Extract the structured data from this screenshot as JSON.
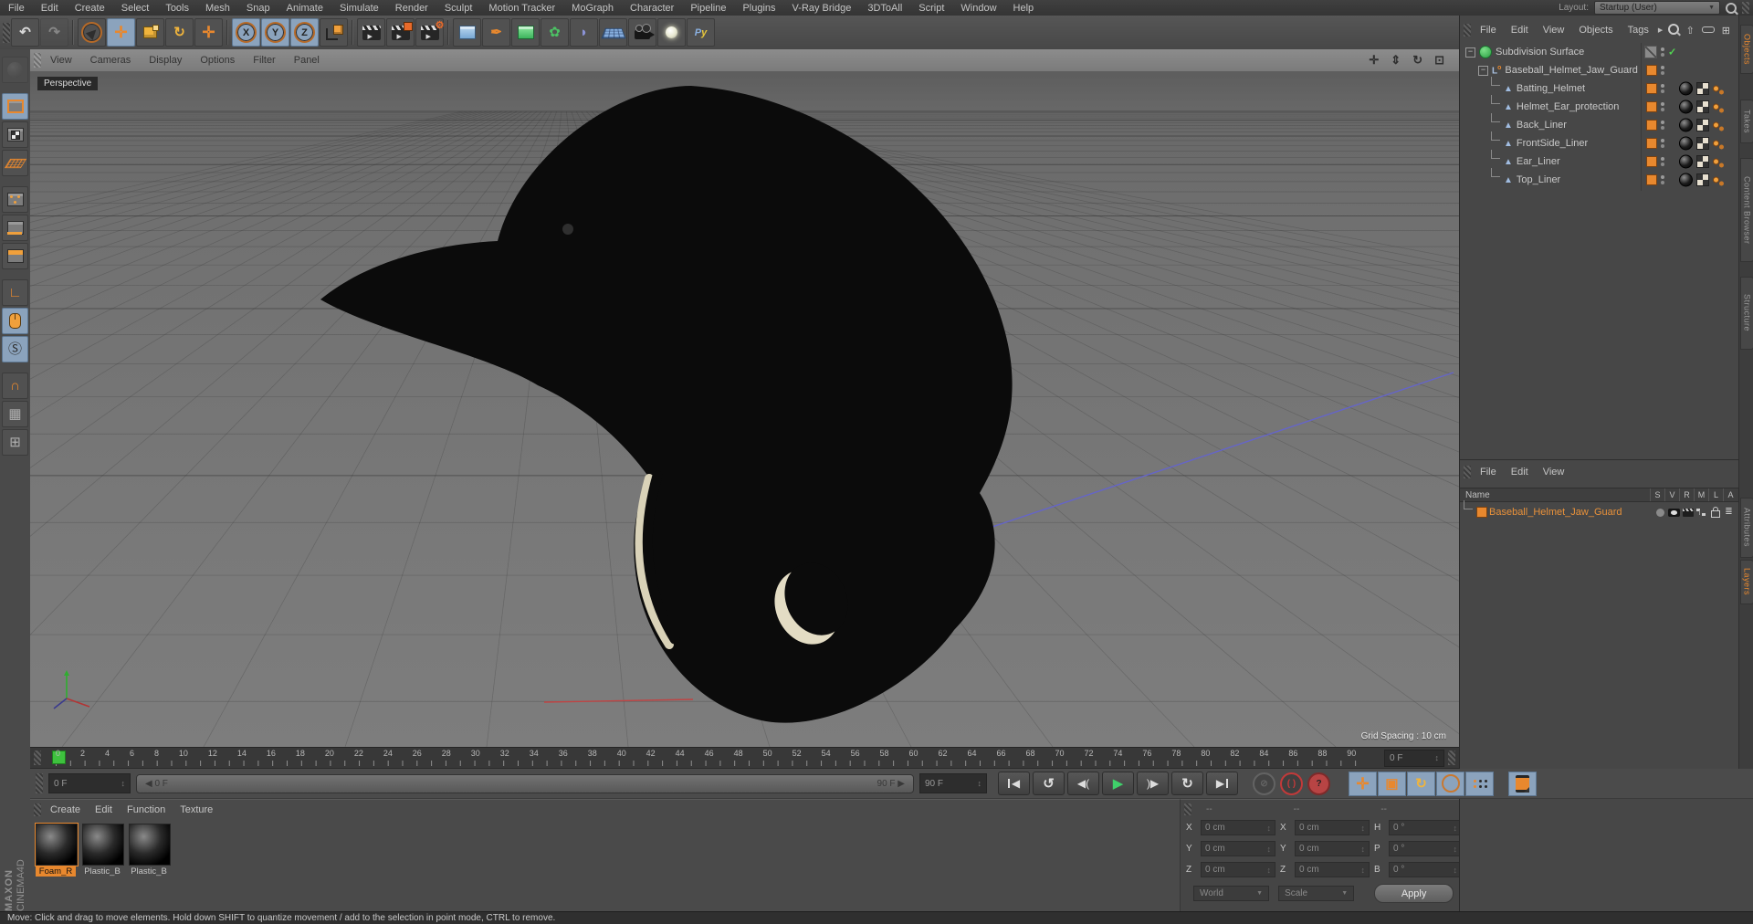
{
  "menubar": {
    "items": [
      "File",
      "Edit",
      "Create",
      "Select",
      "Tools",
      "Mesh",
      "Snap",
      "Animate",
      "Simulate",
      "Render",
      "Sculpt",
      "Motion Tracker",
      "MoGraph",
      "Character",
      "Pipeline",
      "Plugins",
      "V-Ray Bridge",
      "3DToAll",
      "Script",
      "Window",
      "Help"
    ],
    "layout_label": "Layout:",
    "layout_value": "Startup (User)"
  },
  "toolbar": {
    "items": [
      {
        "name": "undo-button",
        "icon": "undo-icon"
      },
      {
        "name": "redo-button",
        "icon": "redo-icon",
        "disabled": true
      },
      {
        "sep": true
      },
      {
        "name": "live-selection-tool",
        "icon": "selection-arrow-icon"
      },
      {
        "name": "move-tool",
        "icon": "move-icon",
        "active": true
      },
      {
        "name": "scale-tool",
        "icon": "scale-icon"
      },
      {
        "name": "rotate-tool",
        "icon": "rotate-icon"
      },
      {
        "name": "last-used-tool",
        "icon": "move-icon"
      },
      {
        "sep": true
      },
      {
        "name": "x-axis-lock",
        "icon": "axis-x-icon",
        "active": true
      },
      {
        "name": "y-axis-lock",
        "icon": "axis-y-icon",
        "active": true
      },
      {
        "name": "z-axis-lock",
        "icon": "axis-z-icon",
        "active": true
      },
      {
        "name": "coordinate-system-toggle",
        "icon": "coord-system-icon"
      },
      {
        "sep": true
      },
      {
        "name": "render-view-button",
        "icon": "render-view-icon"
      },
      {
        "name": "render-picture-viewer-button",
        "icon": "render-pv-icon"
      },
      {
        "name": "render-settings-button",
        "icon": "render-settings-icon"
      },
      {
        "sep": true
      },
      {
        "name": "primitive-object-menu",
        "icon": "cube-icon"
      },
      {
        "name": "spline-object-menu",
        "icon": "pen-icon"
      },
      {
        "name": "generator-object-menu",
        "icon": "subdiv-cube-icon"
      },
      {
        "name": "modeling-object-menu",
        "icon": "flower-icon"
      },
      {
        "name": "deformer-object-menu",
        "icon": "deformer-icon"
      },
      {
        "name": "environment-object-menu",
        "icon": "floor-icon"
      },
      {
        "name": "camera-object-menu",
        "icon": "camera-icon"
      },
      {
        "name": "light-object-menu",
        "icon": "light-icon"
      },
      {
        "name": "scripting-menu",
        "icon": "python-icon"
      }
    ]
  },
  "sidebar": {
    "items": [
      {
        "name": "convert-mode",
        "icon": "sculpt-icon",
        "disabled": true
      },
      {
        "name": "model-mode",
        "icon": "cube-model-icon",
        "active": true,
        "gap": true
      },
      {
        "name": "texture-mode",
        "icon": "cube-texture-icon"
      },
      {
        "name": "workplane-mode",
        "icon": "workplane-icon"
      },
      {
        "name": "points-mode",
        "icon": "cube-points-icon",
        "gap": true
      },
      {
        "name": "edges-mode",
        "icon": "cube-edges-icon"
      },
      {
        "name": "polygons-mode",
        "icon": "cube-polygons-icon"
      },
      {
        "name": "axis-mode",
        "icon": "axis-icon",
        "gap": true
      },
      {
        "name": "tweak-mode",
        "icon": "mouse-icon",
        "active": true
      },
      {
        "name": "snap-toggle",
        "icon": "snap-icon",
        "active": true
      },
      {
        "name": "magnet-snap-toggle",
        "icon": "magnet-icon",
        "gap": true
      },
      {
        "name": "workplane-lock-toggle",
        "icon": "grid-lock-icon"
      },
      {
        "name": "quantize-toggle",
        "icon": "quantize-icon"
      }
    ]
  },
  "viewport": {
    "menu_items": [
      "View",
      "Cameras",
      "Display",
      "Options",
      "Filter",
      "Panel"
    ],
    "view_label": "Perspective",
    "grid_spacing_label": "Grid Spacing : 10 cm",
    "nav_icons": [
      "pan-view-icon",
      "zoom-view-icon",
      "rotate-view-icon",
      "toggle-view-icon"
    ]
  },
  "object_manager": {
    "menu_items": [
      "File",
      "Edit",
      "View",
      "Objects",
      "Tags"
    ],
    "menu_arrow": "▶",
    "tool_icons": [
      "search-icon",
      "up-level-icon",
      "remove-icon",
      "add-icon"
    ],
    "tree": [
      {
        "label": "Subdivision Surface",
        "depth": 0,
        "icon": "subdivision-surface-icon",
        "expander": true,
        "enable_slash": true,
        "check": true
      },
      {
        "label": "Baseball_Helmet_Jaw_Guard",
        "depth": 1,
        "icon": "null-object-icon",
        "expander": true,
        "layer": true,
        "dots": true
      },
      {
        "label": "Batting_Helmet",
        "depth": 2,
        "icon": "polygon-object-icon",
        "layer": true,
        "dots": true,
        "tags": true
      },
      {
        "label": "Helmet_Ear_protection",
        "depth": 2,
        "icon": "polygon-object-icon",
        "layer": true,
        "dots": true,
        "tags": true
      },
      {
        "label": "Back_Liner",
        "depth": 2,
        "icon": "polygon-object-icon",
        "layer": true,
        "dots": true,
        "tags": true
      },
      {
        "label": "FrontSide_Liner",
        "depth": 2,
        "icon": "polygon-object-icon",
        "layer": true,
        "dots": true,
        "tags": true
      },
      {
        "label": "Ear_Liner",
        "depth": 2,
        "icon": "polygon-object-icon",
        "layer": true,
        "dots": true,
        "tags": true
      },
      {
        "label": "Top_Liner",
        "depth": 2,
        "icon": "polygon-object-icon",
        "layer": true,
        "dots": true,
        "tags": true
      }
    ]
  },
  "side_tabs": {
    "upper": [
      {
        "label": "Objects",
        "active": true
      },
      {
        "label": "Takes",
        "active": false
      },
      {
        "label": "Content Browser",
        "active": false
      },
      {
        "label": "Structure",
        "active": false
      }
    ],
    "lower": [
      {
        "label": "Attributes",
        "active": false
      },
      {
        "label": "Layers",
        "active": true
      }
    ]
  },
  "layers_panel": {
    "menu_items": [
      "File",
      "Edit",
      "View"
    ],
    "name_header": "Name",
    "columns": [
      "S",
      "V",
      "R",
      "M",
      "L",
      "A"
    ],
    "row": {
      "label": "Baseball_Helmet_Jaw_Guard",
      "icons": [
        "solo-icon",
        "visibility-icon",
        "render-toggle-icon",
        "manager-icon",
        "lock-icon",
        "animation-icon"
      ]
    }
  },
  "timeline": {
    "start": 0,
    "end": 90,
    "step": 2,
    "current": 0,
    "current_field": "0 F"
  },
  "playback": {
    "start_field": "0 F",
    "slider_start": "0 F",
    "slider_end": "90 F",
    "end_field": "90 F",
    "transport": [
      {
        "name": "goto-start-button",
        "icon": "skip-start-icon"
      },
      {
        "name": "play-backward-button",
        "icon": "ccw-icon"
      },
      {
        "name": "previous-frame-button",
        "icon": "prev-frame-icon"
      },
      {
        "name": "play-button",
        "icon": "play-icon"
      },
      {
        "name": "next-frame-button",
        "icon": "next-frame-icon"
      },
      {
        "name": "play-forward-button",
        "icon": "cw-icon"
      },
      {
        "name": "goto-end-button",
        "icon": "skip-end-icon"
      }
    ],
    "record_buttons": [
      {
        "name": "sound-toggle",
        "icon": "mute-icon",
        "disabled": true
      },
      {
        "name": "record-keyframe-button",
        "icon": "record-icon"
      },
      {
        "name": "autokey-help-button",
        "icon": "question-icon"
      }
    ],
    "key_toggles": [
      {
        "name": "position-key-toggle",
        "icon": "move-icon"
      },
      {
        "name": "scale-key-toggle",
        "icon": "scale-key-icon"
      },
      {
        "name": "rotation-key-toggle",
        "icon": "rotate-icon"
      },
      {
        "name": "parameter-key-toggle",
        "icon": "parameter-icon"
      },
      {
        "name": "pla-key-toggle",
        "icon": "pla-icon"
      }
    ],
    "filmstrip": {
      "name": "animation-palette-button",
      "icon": "filmstrip-icon"
    }
  },
  "materials_panel": {
    "menu_items": [
      "Create",
      "Edit",
      "Function",
      "Texture"
    ],
    "materials": [
      {
        "label": "Foam_R",
        "selected": true
      },
      {
        "label": "Plastic_B",
        "selected": false
      },
      {
        "label": "Plastic_B",
        "selected": false
      }
    ]
  },
  "coordinates": {
    "header": [
      "--",
      "--",
      "--"
    ],
    "position_labels": [
      "X",
      "Y",
      "Z"
    ],
    "position_values": [
      "0 cm",
      "0 cm",
      "0 cm"
    ],
    "size_labels": [
      "X",
      "Y",
      "Z"
    ],
    "size_values": [
      "0 cm",
      "0 cm",
      "0 cm"
    ],
    "rotation_labels": [
      "H",
      "P",
      "B"
    ],
    "rotation_values": [
      "0 °",
      "0 °",
      "0 °"
    ],
    "space_dropdown": "World",
    "mode_dropdown": "Scale",
    "apply_label": "Apply"
  },
  "status_bar": {
    "message": "Move: Click and drag to move elements. Hold down SHIFT to quantize movement / add to the selection in point mode, CTRL to remove."
  },
  "branding": {
    "maxon": "MAXON",
    "cinema": "CINEMA4D"
  },
  "colors": {
    "accent_orange": "#E8882E",
    "selection_blue": "#8BA3BD",
    "record_red": "#C23A3A",
    "play_green": "#3FD16A",
    "layer_text_orange": "#E8913A"
  }
}
